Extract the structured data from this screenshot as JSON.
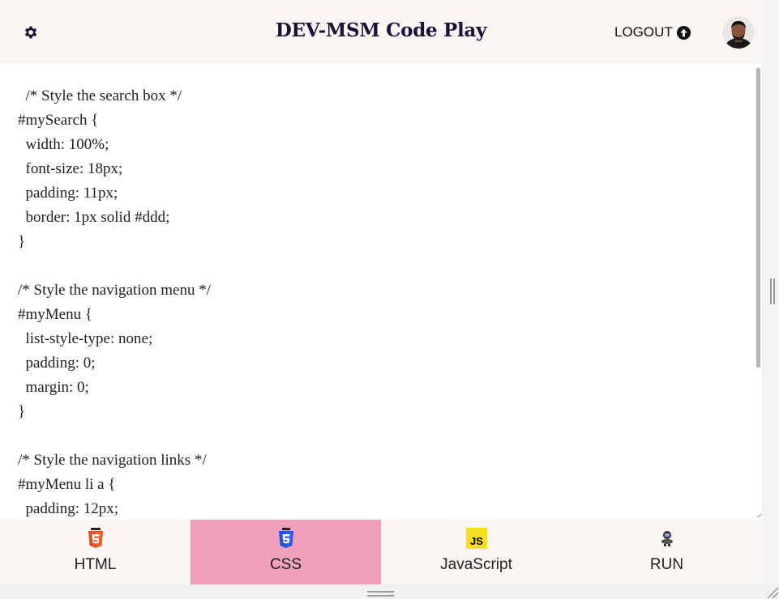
{
  "header": {
    "title": "DEV-MSM Code Play",
    "logout_label": "LOGOUT",
    "settings_icon": "gear-icon",
    "logout_icon": "arrow-up-circle-icon",
    "avatar_icon": "user-avatar"
  },
  "editor": {
    "language": "CSS",
    "code": "  /* Style the search box */\n#mySearch {\n  width: 100%;\n  font-size: 18px;\n  padding: 11px;\n  border: 1px solid #ddd;\n}\n\n/* Style the navigation menu */\n#myMenu {\n  list-style-type: none;\n  padding: 0;\n  margin: 0;\n}\n\n/* Style the navigation links */\n#myMenu li a {\n  padding: 12px;"
  },
  "tabs": [
    {
      "label": "HTML",
      "icon": "html5-icon",
      "active": false
    },
    {
      "label": "CSS",
      "icon": "css3-icon",
      "active": true
    },
    {
      "label": "JavaScript",
      "icon": "javascript-icon",
      "active": false
    },
    {
      "label": "RUN",
      "icon": "astronaut-icon",
      "active": false
    }
  ],
  "colors": {
    "header_bg": "#faf6f4",
    "title": "#1c1236",
    "active_tab": "#f0a0bd",
    "html5": "#e44d26",
    "css3": "#264de4",
    "javascript": "#f7df1e"
  }
}
